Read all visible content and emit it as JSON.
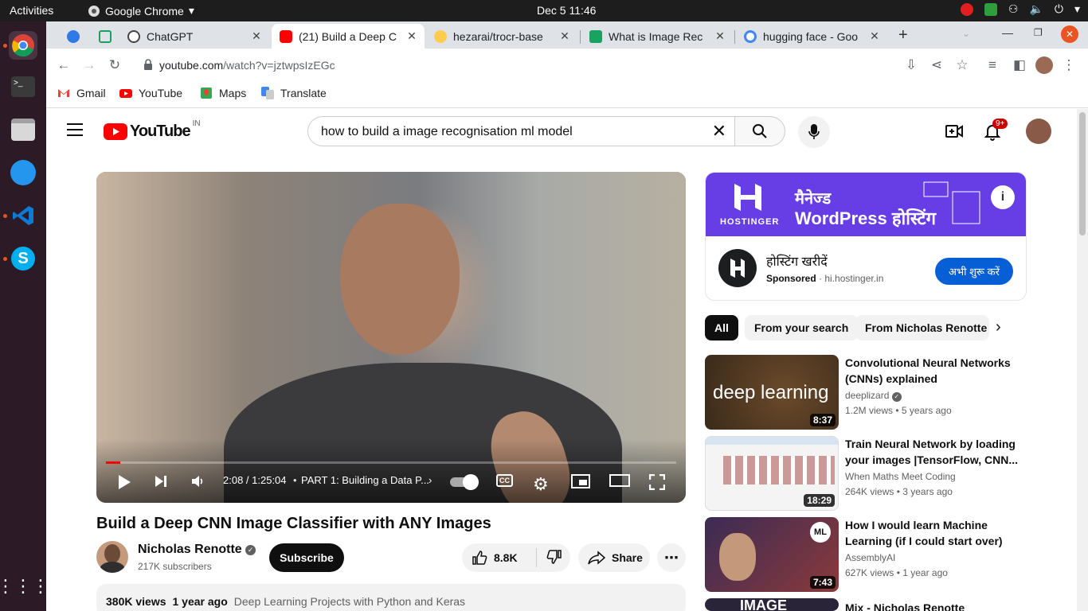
{
  "system": {
    "activities": "Activities",
    "app_name": "Google Chrome",
    "clock": "Dec 5  11:46"
  },
  "dock": {
    "items": [
      "chrome-icon",
      "terminal-icon",
      "files-icon",
      "docker-icon",
      "vscode-icon",
      "skype-icon"
    ],
    "apps_grid": "show-applications-icon"
  },
  "tabs": [
    {
      "title": "",
      "icon": "k-icon",
      "active": false
    },
    {
      "title": "",
      "icon": "green-square-icon",
      "active": false
    },
    {
      "title": "ChatGPT",
      "icon": "chatgpt-icon",
      "active": false
    },
    {
      "title": "(21) Build a Deep C",
      "icon": "youtube-icon",
      "active": true
    },
    {
      "title": "hezarai/trocr-base",
      "icon": "hugging-face-icon",
      "active": false
    },
    {
      "title": "What is Image Rec",
      "icon": "r-icon",
      "active": false
    },
    {
      "title": "hugging face - Goo",
      "icon": "google-icon",
      "active": false
    }
  ],
  "address_bar": {
    "domain": "youtube.com",
    "path": "/watch?v=jztwpsIzEGc"
  },
  "bookmarks": [
    {
      "label": "Gmail",
      "icon": "gmail-icon"
    },
    {
      "label": "YouTube",
      "icon": "youtube-icon"
    },
    {
      "label": "Maps",
      "icon": "maps-icon"
    },
    {
      "label": "Translate",
      "icon": "translate-icon"
    }
  ],
  "youtube": {
    "logo_text": "YouTube",
    "country": "IN",
    "search_query": "how to build a image recognisation ml model",
    "notifications_badge": "9+"
  },
  "player": {
    "time": "2:08 / 1:25:04",
    "chapter": "PART 1: Building a Data P...",
    "progress_fraction": 0.025
  },
  "video": {
    "title": "Build a Deep CNN Image Classifier with ANY Images",
    "channel": "Nicholas Renotte",
    "subscribers": "217K subscribers",
    "subscribe_label": "Subscribe",
    "likes": "8.8K",
    "share_label": "Share",
    "views": "380K views",
    "age": "1 year ago",
    "playlist": "Deep Learning Projects with Python and Keras"
  },
  "ad": {
    "brand": "HOSTINGER",
    "banner_line1": "मैनेज्ड",
    "banner_line2": "WordPress होस्टिंग",
    "title": "होस्टिंग खरीदें",
    "sponsored": "Sponsored",
    "domain": "hi.hostinger.in",
    "cta": "अभी शुरू करें"
  },
  "chips": [
    "All",
    "From your search",
    "From Nicholas Renotte"
  ],
  "recommendations": [
    {
      "title": "Convolutional Neural Networks (CNNs) explained",
      "channel": "deeplizard",
      "verified": true,
      "views": "1.2M views",
      "age": "5 years ago",
      "duration": "8:37",
      "thumb_text": "deep learning"
    },
    {
      "title": "Train Neural Network by loading your images |TensorFlow, CNN...",
      "channel": "When Maths Meet Coding",
      "verified": false,
      "views": "264K views",
      "age": "3 years ago",
      "duration": "18:29",
      "thumb_text": ""
    },
    {
      "title": "How I would learn Machine Learning (if I could start over)",
      "channel": "AssemblyAI",
      "verified": false,
      "views": "627K views",
      "age": "1 year ago",
      "duration": "7:43",
      "thumb_text": "ML"
    },
    {
      "title": "Mix - Nicholas Renotte",
      "channel": "",
      "verified": false,
      "views": "",
      "age": "",
      "duration": "",
      "thumb_text": "IMAGE"
    }
  ]
}
